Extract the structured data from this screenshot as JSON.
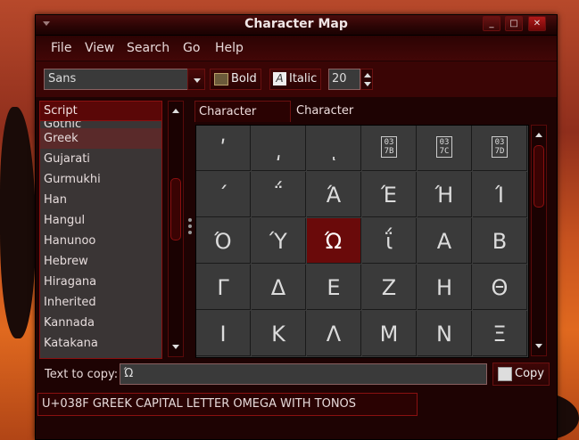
{
  "window": {
    "title": "Character Map"
  },
  "menubar": {
    "items": [
      "File",
      "View",
      "Search",
      "Go",
      "Help"
    ]
  },
  "toolbar": {
    "font_family": "Sans",
    "bold_label": "Bold",
    "italic_label": "Italic",
    "font_size": "20"
  },
  "script_list": {
    "header": "Script",
    "items": [
      "Gothic",
      "Greek",
      "Gujarati",
      "Gurmukhi",
      "Han",
      "Hangul",
      "Hanunoo",
      "Hebrew",
      "Hiragana",
      "Inherited",
      "Kannada",
      "Katakana"
    ],
    "selected": "Greek"
  },
  "tabs": {
    "table": "Character Table",
    "details": "Character Details"
  },
  "char_grid": {
    "rows": [
      [
        "ʹ",
        "͵",
        "ͺ",
        "037B",
        "037C",
        "037D"
      ],
      [
        "΄",
        "΅",
        "Ά",
        "Έ",
        "Ή",
        "Ί"
      ],
      [
        "Ό",
        "Ύ",
        "Ώ",
        "ΐ",
        "Α",
        "Β"
      ],
      [
        "Γ",
        "Δ",
        "Ε",
        "Ζ",
        "Η",
        "Θ"
      ],
      [
        "Ι",
        "Κ",
        "Λ",
        "Μ",
        "Ν",
        "Ξ"
      ]
    ],
    "selected": "Ώ"
  },
  "text_to_copy": {
    "label": "Text to copy:",
    "value": "Ώ",
    "copy_label": "Copy"
  },
  "status": {
    "text": "U+038F GREEK CAPITAL LETTER OMEGA WITH TONOS"
  },
  "colors": {
    "accent": "#6a0a0a",
    "frame": "#8a1010",
    "bg": "#1e0303"
  }
}
